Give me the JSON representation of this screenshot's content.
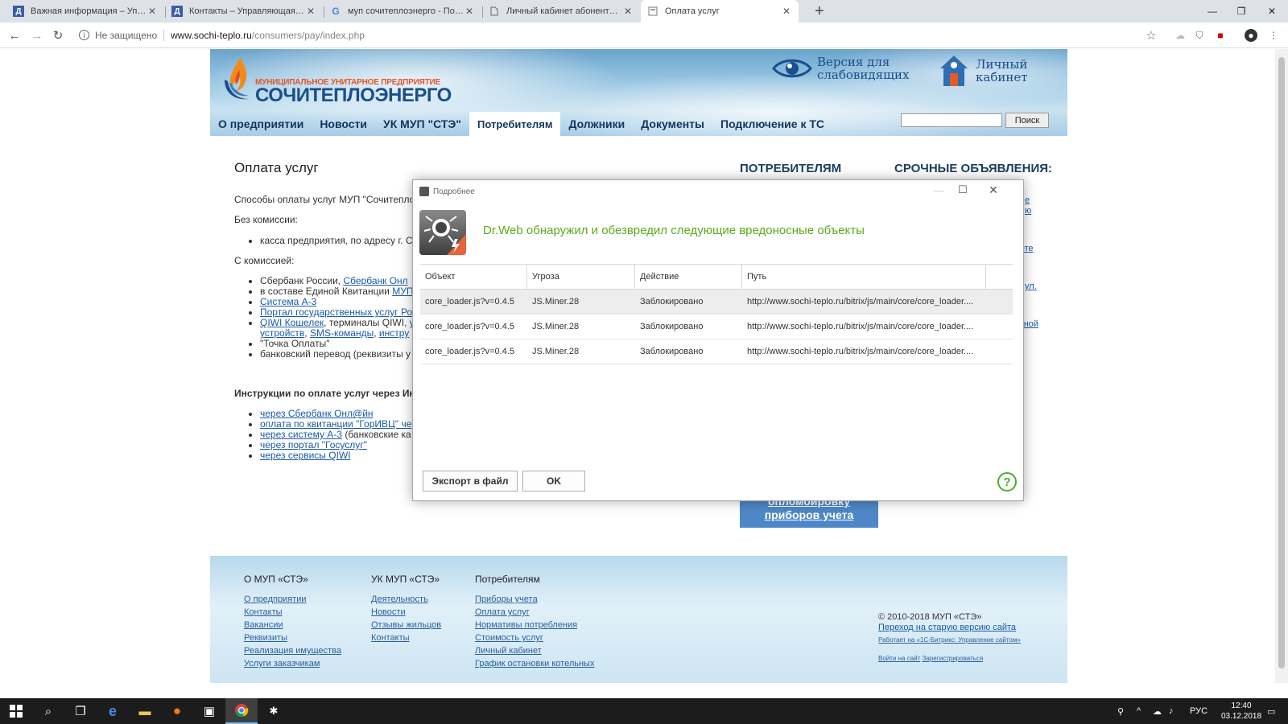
{
  "browser": {
    "tabs": [
      {
        "title": "Важная информация – Управля",
        "icon": "uk-site-icon"
      },
      {
        "title": "Контакты – Управляющая Комп",
        "icon": "uk-site-icon"
      },
      {
        "title": "муп сочитеплоэнерго - Поиск в",
        "icon": "google-icon"
      },
      {
        "title": "Личный кабинет абонента МУП",
        "icon": "page-icon"
      },
      {
        "title": "Оплата услуг",
        "icon": "page-icon",
        "active": true
      }
    ],
    "new_tab": "+",
    "address": {
      "security": "Не защищено",
      "host": "www.sochi-teplo.ru",
      "path": "/consumers/pay/index.php"
    }
  },
  "site": {
    "logo": {
      "subtitle": "МУНИЦИПАЛЬНОЕ УНИТАРНОЕ ПРЕДПРИЯТИЕ",
      "name": "СОЧИТЕПЛОЭНЕРГО"
    },
    "low_vision": "Версия для слабовидящих",
    "cabinet": "Личный кабинет",
    "nav": [
      "О предприятии",
      "Новости",
      "УК МУП \"СТЭ\"",
      "Потребителям",
      "Должники",
      "Документы",
      "Подключение к ТС"
    ],
    "nav_active_index": 3,
    "search_button": "Поиск",
    "page_title": "Оплата услуг",
    "intro": "Способы оплаты услуг МУП \"Сочитепло",
    "no_commission": "Без комиссии:",
    "no_commission_items": [
      "касса предприятия, по адресу г. С"
    ],
    "with_commission": "С комиссией:",
    "commission_items": {
      "sber_prefix": "Сбербанк России, ",
      "sber_link": "Сбербанк Онл",
      "epd_prefix": "в составе Единой Квитанции ",
      "epd_link": "МУП",
      "a3": "Система А-3",
      "gosuslugi": "Портал государственных услуг Ро",
      "qiwi_link": "QIWI Кошелек",
      "qiwi_text": ", терминалы QIWI, ",
      "qiwi_more": "у",
      "devices": "устройств",
      "sms": "SMS-команды",
      "instr": "инстру",
      "tochka": "\"Точка Оплаты\"",
      "bank": "банковский перевод (реквизиты у"
    },
    "instructions_title": "Инструкции по оплате услуг через Ин",
    "instructions": [
      {
        "link": "через Сбербанк Онл@йн",
        "tail": ""
      },
      {
        "link": "оплата по квитанции \"ГорИВЦ\" че",
        "tail": ""
      },
      {
        "link": "через систему А-3",
        "tail": " (банковские ка"
      },
      {
        "link": "через портал \"Госуслуг\"",
        "tail": ""
      },
      {
        "link": "через сервисы QIWI",
        "tail": ""
      }
    ],
    "sidebar_title": "ПОТРЕБИТЕЛЯМ",
    "urgent_title": "СРОЧНЫЕ ОБЪЯВЛЕНИЯ:",
    "urgent_fragments": [
      "е",
      "ю",
      "чете",
      "ул.",
      "ьной"
    ],
    "meter_button": {
      "line1": "опломбировку",
      "line2": "приборов учета"
    },
    "footer": {
      "cols": [
        {
          "title": "О МУП «СТЭ»",
          "links": [
            "О предприятии",
            "Контакты",
            "Вакансии",
            "Реквизиты",
            "Реализация имущества",
            "Услуги заказчикам"
          ]
        },
        {
          "title": "УК МУП «СТЭ»",
          "links": [
            "Деятельность",
            "Новости",
            "Отзывы жильцов",
            "Контакты"
          ]
        },
        {
          "title": "Потребителям",
          "links": [
            "Приборы учета",
            "Оплата услуг",
            "Нормативы потребления",
            "Стоимость услуг",
            "Личный кабинет",
            "График остановки котельных"
          ]
        }
      ],
      "copyright": "© 2010-2018 МУП «СТЭ»",
      "old_version": "Переход на старую версию сайта",
      "powered": "Работает на «1С-Битрикс: Управление сайтом»",
      "login": "Войти на сайт",
      "register": "Зарегистрироваться"
    }
  },
  "dialog": {
    "title": "Подробнее",
    "message": "Dr.Web обнаружил и обезвредил следующие вредоносные объекты",
    "columns": [
      "Объект",
      "Угроза",
      "Действие",
      "Путь"
    ],
    "rows": [
      [
        "core_loader.js?v=0.4.5",
        "JS.Miner.28",
        "Заблокировано",
        "http://www.sochi-teplo.ru/bitrix/js/main/core/core_loader...."
      ],
      [
        "core_loader.js?v=0.4.5",
        "JS.Miner.28",
        "Заблокировано",
        "http://www.sochi-teplo.ru/bitrix/js/main/core/core_loader...."
      ],
      [
        "core_loader.js?v=0.4.5",
        "JS.Miner.28",
        "Заблокировано",
        "http://www.sochi-teplo.ru/bitrix/js/main/core/core_loader...."
      ]
    ],
    "export_button": "Экспорт в файл",
    "ok_button": "OK",
    "help": "?",
    "accent": "#5aab1f"
  },
  "taskbar": {
    "lang": "РУС",
    "time": "12:40",
    "date": "03.12.2018"
  }
}
